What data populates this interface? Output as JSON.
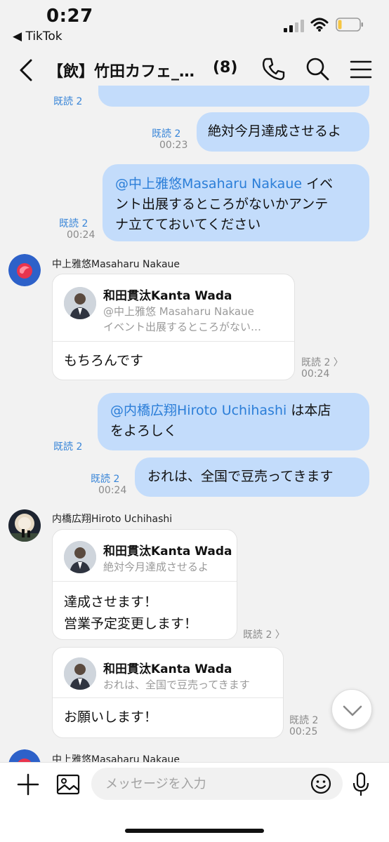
{
  "status_bar": {
    "time": "0:27",
    "back_app": "◀ TikTok"
  },
  "header": {
    "title": "【飲】竹田カフェ_…",
    "member_count": "(8)"
  },
  "messages": {
    "m0": {
      "read": "既読 2"
    },
    "m1": {
      "text": "絶対今月達成させるよ",
      "read": "既読 2",
      "time": "00:23"
    },
    "m2": {
      "mention": "@中上雅悠Masaharu Nakaue",
      "text_a": " イベ",
      "line2": "ント出展するところがないかアンテ",
      "line3": "ナ立てておいてください",
      "read": "既読 2",
      "time": "00:24"
    },
    "m3": {
      "sender": "中上雅悠Masaharu Nakaue",
      "quote_name": "和田貫汰Kanta Wada",
      "quote_line1": "@中上雅悠 Masaharu Nakaue",
      "quote_line2": "イベント出展するところがない…",
      "reply": "もちろんです",
      "read": "既読 2 〉",
      "time": "00:24"
    },
    "m4": {
      "mention": "@内橋広翔Hiroto Uchihashi",
      "text_a": " は本店",
      "line2": "をよろしく",
      "read": "既読 2"
    },
    "m5": {
      "text": "おれは、全国で豆売ってきます",
      "read": "既読 2",
      "time": "00:24"
    },
    "m6": {
      "sender": "内橋広翔Hiroto Uchihashi",
      "quote_name": "和田貫汰Kanta Wada",
      "quote_line1": "絶対今月達成させるよ",
      "reply_line1": "達成させます！",
      "reply_line2": "営業予定変更します！",
      "read": "既読 2 〉"
    },
    "m7": {
      "quote_name": "和田貫汰Kanta Wada",
      "quote_line1": "おれは、全国で豆売ってきます",
      "reply": "お願いします！",
      "read": "既読 2",
      "time": "00:25"
    },
    "m8": {
      "sender": "中上雅悠Masaharu Nakaue"
    }
  },
  "composer": {
    "placeholder": "メッセージを入力"
  },
  "colors": {
    "my_bubble": "#c3dcfb",
    "mention": "#2b7ed8",
    "read_receipt": "#3a86d8",
    "background": "#f2f2f2"
  },
  "icons": [
    "signal-icon",
    "wifi-icon",
    "battery-icon",
    "back-icon",
    "phone-icon",
    "search-icon",
    "menu-icon",
    "plus-icon",
    "image-icon",
    "emoji-icon",
    "mic-icon",
    "chevron-down-icon"
  ]
}
